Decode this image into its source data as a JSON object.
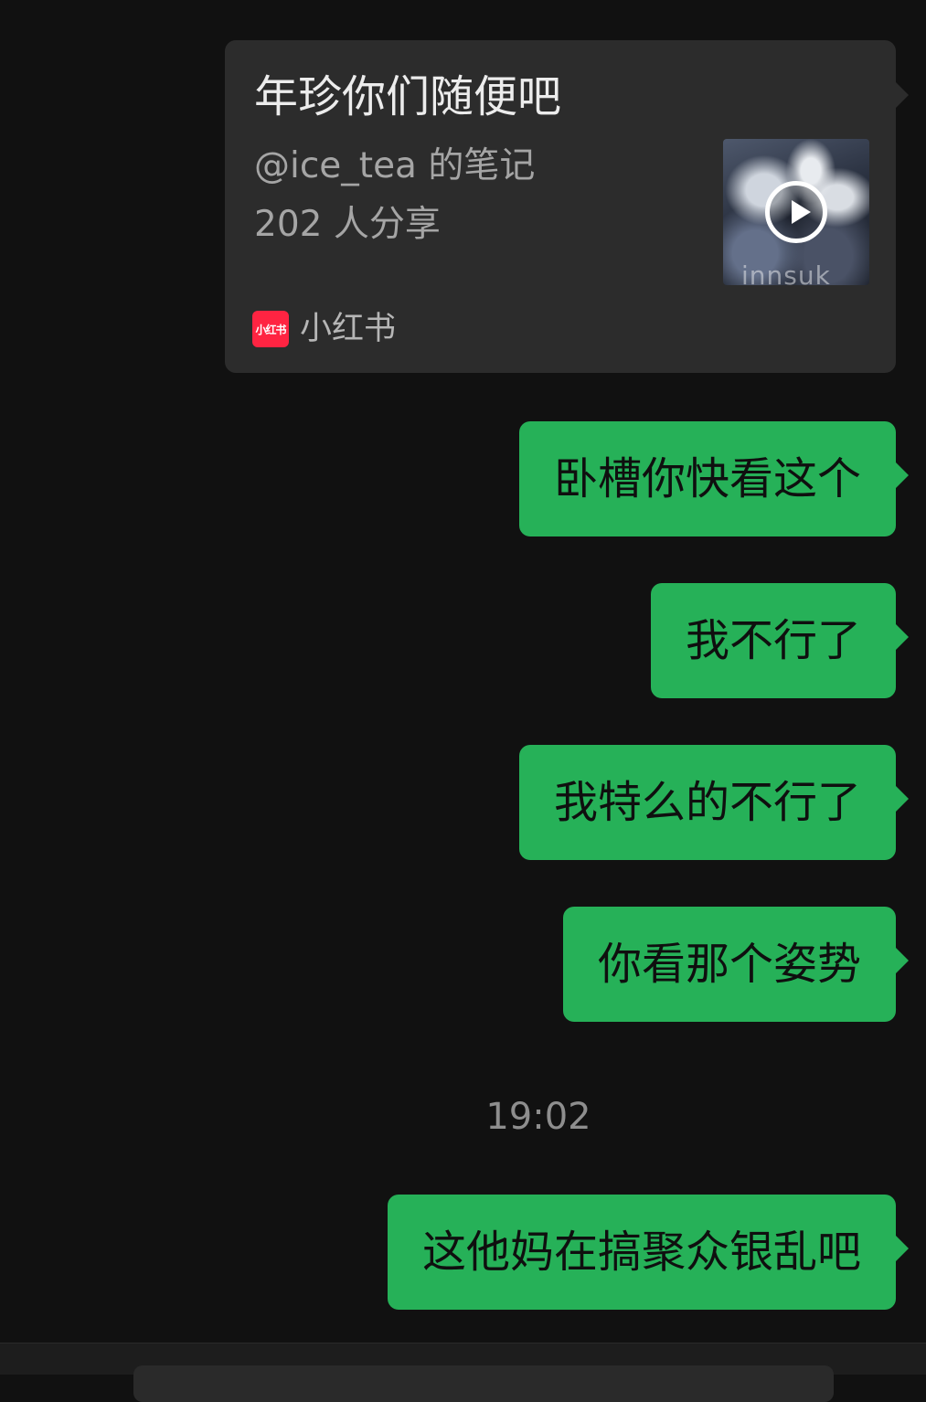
{
  "share_card": {
    "title": "年珍你们随便吧",
    "author": "@ice_tea 的笔记",
    "shares": "202 人分享",
    "thumbnail_watermark": "innsuk",
    "source_logo_text": "小红书",
    "source_name": "小红书",
    "play_icon": "play-circle-icon"
  },
  "messages": [
    {
      "text": "卧槽你快看这个"
    },
    {
      "text": "我不行了"
    },
    {
      "text": "我特么的不行了"
    },
    {
      "text": "你看那个姿势"
    },
    {
      "text": "这他妈在搞聚众银乱吧"
    }
  ],
  "timestamp": "19:02",
  "colors": {
    "background": "#111111",
    "card": "#2c2c2c",
    "outgoing_bubble": "#26b158",
    "brand_red": "#ff2442"
  }
}
